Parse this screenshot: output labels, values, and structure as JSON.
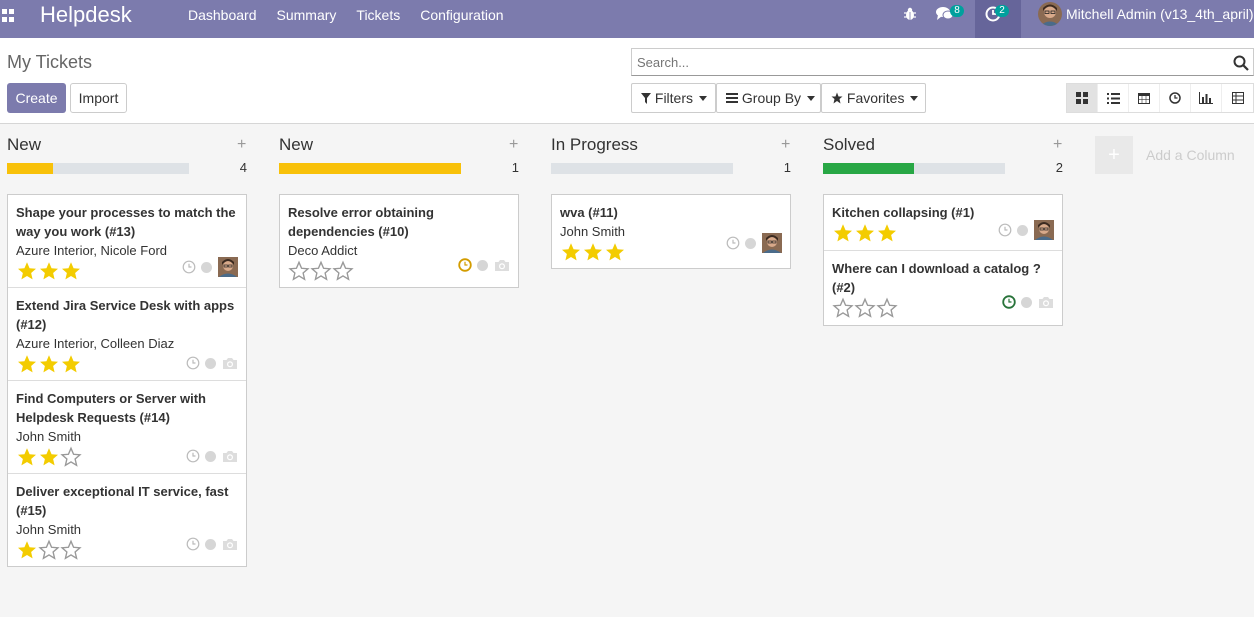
{
  "navbar": {
    "brand": "Helpdesk",
    "menu": [
      "Dashboard",
      "Summary",
      "Tickets",
      "Configuration"
    ],
    "messages_badge": "8",
    "activities_badge": "2",
    "user_name": "Mitchell Admin (v13_4th_april)"
  },
  "control": {
    "title": "My Tickets",
    "create_label": "Create",
    "import_label": "Import",
    "search_placeholder": "Search...",
    "filters_label": "Filters",
    "groupby_label": "Group By",
    "favorites_label": "Favorites"
  },
  "colors": {
    "nav": "#7c7bad",
    "yellow": "#f8c109",
    "green": "#28a745",
    "star": "#f3cc00"
  },
  "columns": [
    {
      "title": "New",
      "count": "4",
      "progress": {
        "yellow": 0.25,
        "green": 0
      },
      "cards": [
        {
          "title": "Shape your processes to match the way you work (#13)",
          "sub": "Azure Interior, Nicole Ford",
          "stars": 3,
          "clock": "gray",
          "right": "avatar"
        },
        {
          "title": "Extend Jira Service Desk with apps (#12)",
          "sub": "Azure Interior, Colleen Diaz",
          "stars": 3,
          "clock": "gray",
          "right": "camera"
        },
        {
          "title": "Find Computers or Server with Helpdesk Requests (#14)",
          "sub": "John Smith",
          "stars": 2,
          "clock": "gray",
          "right": "camera"
        },
        {
          "title": "Deliver exceptional IT service, fast (#15)",
          "sub": "John Smith",
          "stars": 1,
          "clock": "gray",
          "right": "camera"
        }
      ]
    },
    {
      "title": "New",
      "count": "1",
      "progress": {
        "yellow": 1,
        "green": 0
      },
      "cards": [
        {
          "title": "Resolve error obtaining dependencies (#10)",
          "sub": "Deco Addict",
          "stars": 0,
          "clock": "orange",
          "right": "camera"
        }
      ]
    },
    {
      "title": "In Progress",
      "count": "1",
      "progress": {
        "yellow": 0,
        "green": 0
      },
      "cards": [
        {
          "title": "wva (#11)",
          "sub": "John Smith",
          "stars": 3,
          "clock": "gray",
          "right": "avatar"
        }
      ]
    },
    {
      "title": "Solved",
      "count": "2",
      "progress": {
        "yellow": 0,
        "green": 0.5
      },
      "cards": [
        {
          "title": "Kitchen collapsing (#1)",
          "sub": "",
          "stars": 3,
          "clock": "gray",
          "right": "avatar"
        },
        {
          "title": "Where can I download a catalog ? (#2)",
          "sub": "",
          "stars": 0,
          "clock": "green",
          "right": "camera"
        }
      ]
    }
  ],
  "add_column_label": "Add a Column"
}
